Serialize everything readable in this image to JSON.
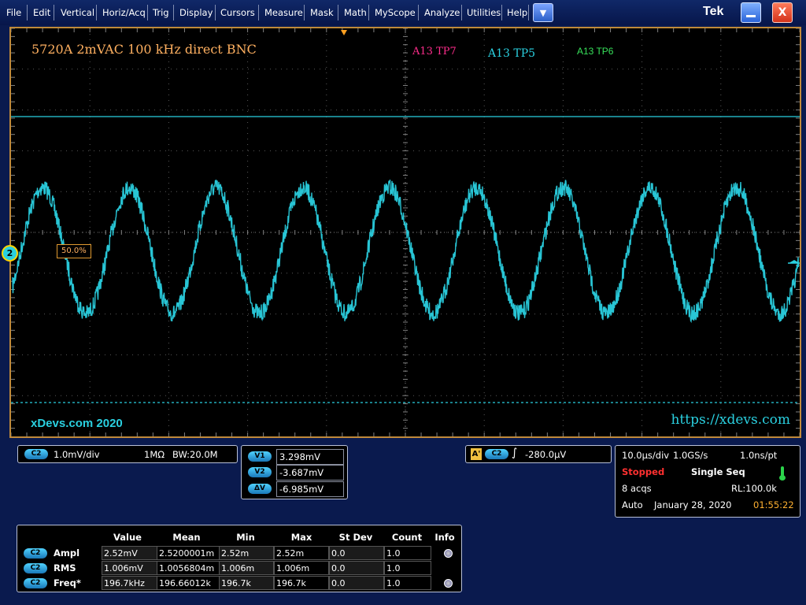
{
  "menu": {
    "items": [
      "File",
      "Edit",
      "Vertical",
      "Horiz/Acq",
      "Trig",
      "Display",
      "Cursors",
      "Measure",
      "Mask",
      "Math",
      "MyScope",
      "Analyze",
      "Utilities",
      "Help"
    ],
    "dropdown_icon": "chevron-down-icon",
    "logo": "Tek",
    "close_glyph": "X"
  },
  "screen": {
    "title": "5720A 2mVAC 100 kHz direct BNC",
    "labels": {
      "tp7": "A13 TP7",
      "tp5": "A13 TP5",
      "tp6": "A13 TP6"
    },
    "watermark_left": "xDevs.com 2020",
    "watermark_right": "https://xdevs.com",
    "channel_marker": "2",
    "trigger_level": "50.0%",
    "colors": {
      "trace": "#2ad0e0",
      "grid": "#5a5a5a",
      "frame": "#c08a3a",
      "tp7": "#ff2d8c",
      "tp6": "#37e05a"
    }
  },
  "channel": {
    "badge": "C2",
    "scale": "1.0mV/div",
    "impedance": "1MΩ",
    "bandwidth": "BW:20.0M"
  },
  "cursors": [
    {
      "tag": "V1",
      "value": "3.298mV"
    },
    {
      "tag": "V2",
      "value": "-3.687mV"
    },
    {
      "tag": "ΔV",
      "value": "-6.985mV"
    }
  ],
  "trigger": {
    "badge_a": "A'",
    "badge_c": "C2",
    "level": "-280.0µV"
  },
  "acquisition": {
    "time_div": "10.0µs/div",
    "sample_rate": "1.0GS/s",
    "resolution": "1.0ns/pt",
    "status": "Stopped",
    "mode": "Single Seq",
    "acqs": "8 acqs",
    "record_length": "RL:100.0k",
    "trigger_mode": "Auto",
    "date": "January 28, 2020",
    "time": "01:55:22"
  },
  "measurements": {
    "headers": [
      "Value",
      "Mean",
      "Min",
      "Max",
      "St Dev",
      "Count",
      "Info"
    ],
    "rows": [
      {
        "badge": "C2",
        "name": "Ampl",
        "value": "2.52mV",
        "mean": "2.5200001m",
        "min": "2.52m",
        "max": "2.52m",
        "stdev": "0.0",
        "count": "1.0",
        "info": true
      },
      {
        "badge": "C2",
        "name": "RMS",
        "value": "1.006mV",
        "mean": "1.0056804m",
        "min": "1.006m",
        "max": "1.006m",
        "stdev": "0.0",
        "count": "1.0",
        "info": false
      },
      {
        "badge": "C2",
        "name": "Freq*",
        "value": "196.7kHz",
        "mean": "196.66012k",
        "min": "196.7k",
        "max": "196.7k",
        "stdev": "0.0",
        "count": "1.0",
        "info": true
      }
    ]
  },
  "waveform": {
    "channel": "C2",
    "shape": "sine",
    "frequency": "196.7kHz",
    "amplitude": "2.52mV",
    "noisy": true
  }
}
